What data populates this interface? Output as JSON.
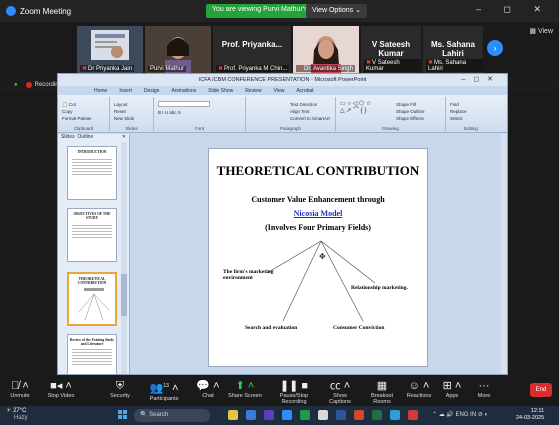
{
  "zoom": {
    "app_title": "Zoom Meeting",
    "share_banner": "You are viewing Purvi Mathur's screen",
    "view_options": "View Options",
    "window_controls": "– ◻ ✕",
    "view_button": "View"
  },
  "participants": [
    {
      "name": "Dr Priyanka Jain",
      "big": ""
    },
    {
      "name": "Purvi Mathur",
      "big": ""
    },
    {
      "name": "Prof. Priyanka M Chin...",
      "big": "Prof. Priyanka..."
    },
    {
      "name": "Dr. Avantika Singh",
      "big": ""
    },
    {
      "name": "V Sateesh Kumar",
      "big": "V Sateesh Kumar"
    },
    {
      "name": "Ms. Sahana Lahiri",
      "big": "Ms. Sahana Lahiri"
    }
  ],
  "recording": {
    "label": "Recording..."
  },
  "powerpoint": {
    "window_title": "ICFA ICBM CONFERENCE PRESENTATION - Microsoft PowerPoint",
    "tabs": [
      "Home",
      "Insert",
      "Design",
      "Animations",
      "Slide Show",
      "Review",
      "View",
      "Acrobat"
    ],
    "ribbon_groups": [
      {
        "label": "Clipboard",
        "items": [
          "Cut",
          "Copy",
          "Paste",
          "Format Painter"
        ]
      },
      {
        "label": "Slides",
        "items": [
          "Layout",
          "Reset",
          "New Slide",
          "Delete"
        ]
      },
      {
        "label": "Font",
        "items": [
          "B I U abc S",
          "Aa A"
        ]
      },
      {
        "label": "Paragraph",
        "items": [
          "Text Direction",
          "Align Text",
          "Convert to SmartArt"
        ]
      },
      {
        "label": "Drawing",
        "items": [
          "Arrange",
          "Quick Styles",
          "Shape Fill",
          "Shape Outline",
          "Shape Effects"
        ]
      },
      {
        "label": "Editing",
        "items": [
          "Find",
          "Replace",
          "Select"
        ]
      }
    ],
    "panel_tabs": [
      "Slides",
      "Outline"
    ],
    "thumbnails": [
      {
        "num": "",
        "title": "INTRODUCTION",
        "selected": false
      },
      {
        "num": "",
        "title": "OBJECTIVES OF THE STUDY",
        "selected": false
      },
      {
        "num": "",
        "title": "THEORETICAL CONTRIBUTION",
        "selected": true
      },
      {
        "num": "",
        "title": "Review of the Existing Study and Literature",
        "selected": false
      }
    ],
    "slide": {
      "title": "THEORETICAL CONTRIBUTION",
      "line1": "Customer Value Enhancement through",
      "line2": "Nicosia Model",
      "line3": "(Involves Four Primary Fields)",
      "fields": {
        "left": "The firm's marketing environment",
        "right": "Relationship marketing.",
        "bottom_left": "Search and evaluation",
        "bottom_right": "Consumer Conviction"
      }
    }
  },
  "toolbar": [
    {
      "icon": "mic-muted-icon",
      "label": "Unmute"
    },
    {
      "icon": "video-off-icon",
      "label": "Stop Video"
    },
    {
      "icon": "shield-icon",
      "label": "Security"
    },
    {
      "icon": "participants-icon",
      "label": "Participants",
      "count": "13"
    },
    {
      "icon": "chat-icon",
      "label": "Chat"
    },
    {
      "icon": "share-screen-icon",
      "label": "Share Screen"
    },
    {
      "icon": "record-icon",
      "label": "Pause/Stop Recording"
    },
    {
      "icon": "cc-icon",
      "label": "Show Captions"
    },
    {
      "icon": "breakout-icon",
      "label": "Breakout Rooms"
    },
    {
      "icon": "reactions-icon",
      "label": "Reactions"
    },
    {
      "icon": "apps-icon",
      "label": "Apps"
    },
    {
      "icon": "more-icon",
      "label": "More"
    }
  ],
  "end_label": "End",
  "taskbar": {
    "temp": "27°C",
    "weather": "Hazy",
    "search_placeholder": "Search",
    "lang": "ENG IN",
    "time": "12:11",
    "date": "24-03-2025"
  }
}
